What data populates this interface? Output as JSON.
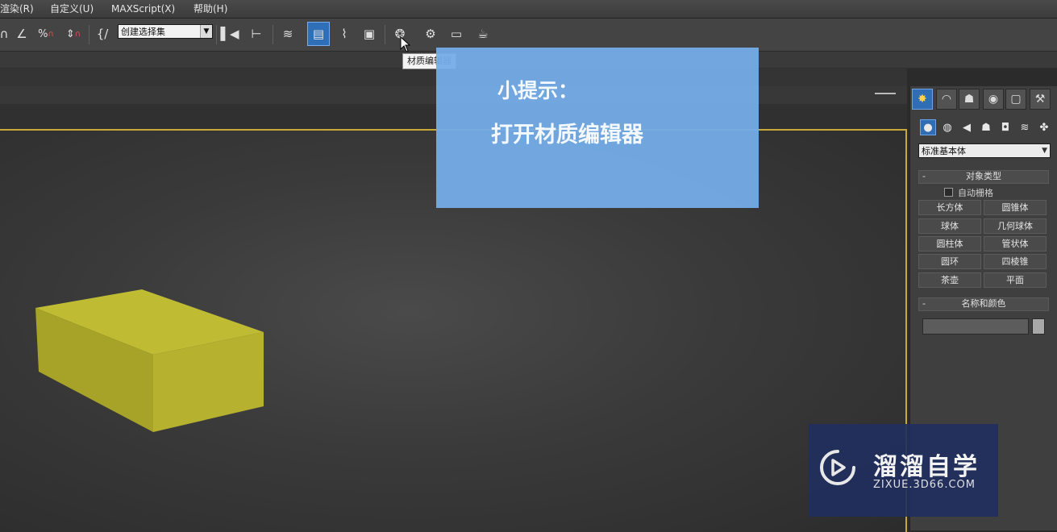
{
  "menubar": {
    "items": [
      {
        "label": "渲染(R)"
      },
      {
        "label": "自定义(U)"
      },
      {
        "label": "MAXScript(X)"
      },
      {
        "label": "帮助(H)"
      }
    ]
  },
  "toolbar": {
    "named_selection_set": "创建选择集",
    "buttons": [
      {
        "icon": "snap-3d-icon"
      },
      {
        "icon": "angle-snap-icon"
      },
      {
        "icon": "percent-snap-icon"
      },
      {
        "icon": "spinner-snap-icon"
      },
      {
        "icon": "edit-named-selection-icon"
      },
      {
        "icon": "mirror-icon"
      },
      {
        "icon": "align-icon"
      },
      {
        "icon": "layer-manager-icon"
      },
      {
        "icon": "graphite-ribbon-icon"
      },
      {
        "icon": "curve-editor-icon"
      },
      {
        "icon": "schematic-view-icon"
      },
      {
        "icon": "material-editor-icon"
      },
      {
        "icon": "render-setup-icon"
      },
      {
        "icon": "rendered-frame-window-icon"
      },
      {
        "icon": "render-production-icon"
      }
    ],
    "tooltip": "材质编辑器"
  },
  "command_panel": {
    "tabs": [
      "create-tab-icon",
      "modify-tab-icon",
      "hierarchy-tab-icon",
      "motion-tab-icon",
      "display-tab-icon",
      "utilities-tab-icon"
    ],
    "sub_icons": [
      "geometry-icon",
      "shapes-icon",
      "lights-icon",
      "cameras-icon",
      "helpers-icon",
      "space-warps-icon",
      "systems-icon"
    ],
    "category": "标准基本体",
    "object_type": {
      "title": "对象类型",
      "collapse": "-",
      "auto_grid": "自动栅格",
      "buttons": [
        "长方体",
        "圆锥体",
        "球体",
        "几何球体",
        "圆柱体",
        "管状体",
        "圆环",
        "四棱锥",
        "茶壶",
        "平面"
      ]
    },
    "name_color": {
      "title": "名称和颜色",
      "collapse": "-",
      "name_value": "",
      "swatch_color": "#a8a8a8"
    }
  },
  "viewport": {
    "box_color": "#b0ad2a",
    "border_color": "#c8a83a"
  },
  "hint": {
    "title": "小提示：",
    "text": "打开材质编辑器"
  },
  "watermark": {
    "brand": "溜溜自学",
    "url": "ZIXUE.3D66.COM"
  }
}
